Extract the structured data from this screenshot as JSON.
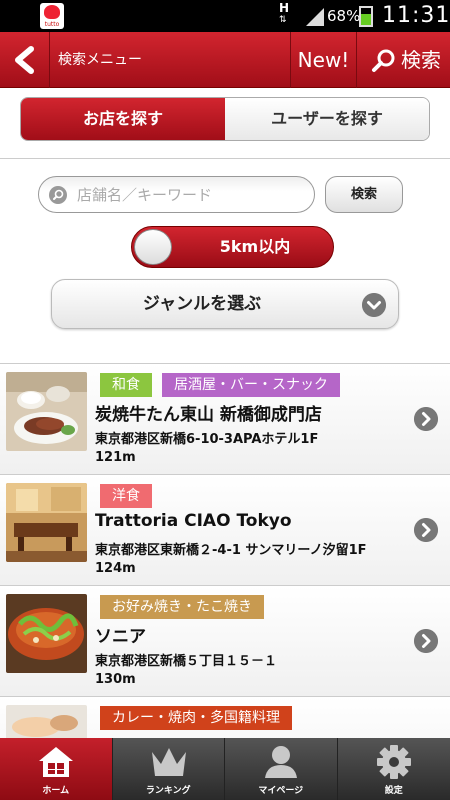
{
  "status_bar": {
    "network": "H",
    "battery": "68%",
    "time": "11:31",
    "app_icon_label": "tutto"
  },
  "header": {
    "title": "検索メニュー",
    "new_label": "New!",
    "search_label": "検索"
  },
  "segments": [
    {
      "label": "お店を探す",
      "active": true
    },
    {
      "label": "ユーザーを探す",
      "active": false
    }
  ],
  "search": {
    "placeholder": "店舗名／キーワード",
    "value": "",
    "button_label": "検索"
  },
  "distance_toggle": {
    "label": "5km以内"
  },
  "genre_select": {
    "label": "ジャンルを選ぶ"
  },
  "results": [
    {
      "tags": [
        {
          "label": "和食",
          "color": "#8cc63f"
        },
        {
          "label": "居酒屋・バー・スナック",
          "color": "#b566c8"
        }
      ],
      "name": "炭焼牛たん東山 新橋御成門店",
      "address": "東京都港区新橋6-10-3APAホテル1F",
      "distance": "121m"
    },
    {
      "tags": [
        {
          "label": "洋食",
          "color": "#f06b70"
        }
      ],
      "name": "Trattoria CIAO Tokyo",
      "address": "東京都港区東新橋２-4-1 サンマリーノ汐留1F",
      "distance": "124m"
    },
    {
      "tags": [
        {
          "label": "お好み焼き・たこ焼き",
          "color": "#c89a50"
        }
      ],
      "name": "ソニア",
      "address": "東京都港区新橋５丁目１５－１",
      "distance": "130m"
    },
    {
      "tags": [
        {
          "label": "カレー・焼肉・多国籍料理",
          "color": "#d0421b"
        }
      ],
      "name": "",
      "address": "",
      "distance": ""
    }
  ],
  "tabbar": [
    {
      "label": "ホーム",
      "icon": "home-icon",
      "active": true
    },
    {
      "label": "ランキング",
      "icon": "crown-icon",
      "active": false
    },
    {
      "label": "マイページ",
      "icon": "person-icon",
      "active": false
    },
    {
      "label": "設定",
      "icon": "gear-icon",
      "active": false
    }
  ]
}
